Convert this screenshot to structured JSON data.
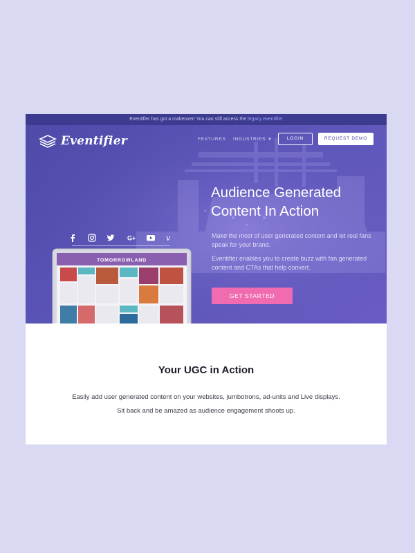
{
  "announcement": {
    "text": "Eventifier has got a makeover! You can still access the ",
    "link": "legacy eventifier"
  },
  "brand": {
    "name": "Eventifier"
  },
  "nav": {
    "features": "FEATURES",
    "industries": "INDUSTRIES",
    "login": "LOGIN",
    "request_demo": "REQUEST DEMO"
  },
  "hero": {
    "headline_line1": "Audience Generated",
    "headline_line2": "Content In Action",
    "paragraph1": "Make the most of user generated content and let real fans speak for your brand.",
    "paragraph2": "Eventifier enables you to create buzz with fan generated content and CTAs that help convert.",
    "cta": "GET STARTED",
    "screen_banner": "TOMORROWLAND"
  },
  "social_icons": [
    "facebook-icon",
    "instagram-icon",
    "twitter-icon",
    "google-plus-icon",
    "youtube-icon",
    "vine-icon"
  ],
  "section": {
    "title": "Your UGC in Action",
    "line1": "Easily add user generated content on your websites, jumbotrons, ad-units and Live displays.",
    "line2": "Sit back and be amazed as audience engagement shoots up."
  },
  "colors": {
    "hero": "#5450b0",
    "cta": "#f06bb0",
    "outer_bg": "#d9d9f4"
  }
}
